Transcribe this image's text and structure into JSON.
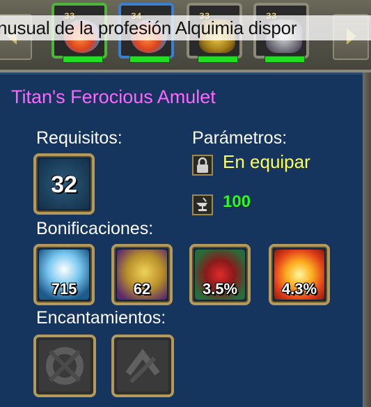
{
  "ticker": {
    "text": "nusual de la profesión Alquimia dispor"
  },
  "inventory_strip": {
    "slots": [
      {
        "level": "33",
        "frame": "#4fb43a",
        "icon": "potion-icon",
        "color": "#d9421e"
      },
      {
        "level": "34",
        "frame": "#3a7fd0",
        "icon": "potion-icon",
        "color": "#d9421e"
      },
      {
        "level": "33",
        "frame": "#8d8a7a",
        "icon": "gold-ore-icon",
        "color": "#c4a030"
      },
      {
        "level": "33",
        "frame": "#8d8a7a",
        "icon": "silver-ore-icon",
        "color": "#8a8a90"
      }
    ]
  },
  "item": {
    "name": "Titan's Ferocious Amulet",
    "requirements_label": "Requisitos:",
    "required_level": "32",
    "parameters_label": "Parámetros:",
    "bind_text": "En equipar",
    "durability": "100",
    "bonuses_label": "Bonificaciones:",
    "bonuses": [
      {
        "value": "715",
        "icon": "armor-icon"
      },
      {
        "value": "62",
        "icon": "strength-icon"
      },
      {
        "value": "3.5%",
        "icon": "crit-icon"
      },
      {
        "value": "4.3%",
        "icon": "fire-icon"
      }
    ],
    "enchantments_label": "Encantamientos:"
  }
}
